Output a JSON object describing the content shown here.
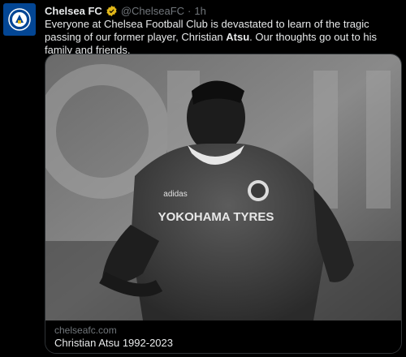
{
  "tweet": {
    "author_name": "Chelsea FC",
    "handle": "@ChelseaFC",
    "separator": "·",
    "time": "1h",
    "text_before": "Everyone at Chelsea Football Club is devastated to learn of the tragic passing of our former player, Christian ",
    "text_bold": "Atsu",
    "text_after": ". Our thoughts go out to his family and friends."
  },
  "card": {
    "domain": "chelseafc.com",
    "title": "Christian Atsu 1992-2023",
    "image_kit_text": "YOKOHAMA TYRES",
    "image_brand_text": "adidas"
  },
  "icons": {
    "avatar": "chelsea-crest-icon",
    "verified": "gold-verified-badge-icon"
  },
  "colors": {
    "background": "#000000",
    "text": "#e7e9ea",
    "muted": "#71767b",
    "avatar_bg": "#034694",
    "badge": "#e2b719"
  }
}
